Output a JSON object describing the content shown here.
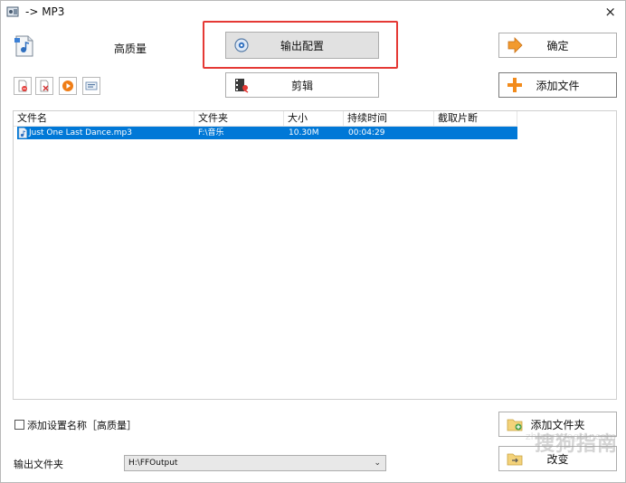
{
  "window": {
    "title": "-> MP3",
    "close_symbol": "×"
  },
  "preset": {
    "label": "高质量"
  },
  "buttons": {
    "output_config": "输出配置",
    "ok": "确定",
    "clip": "剪辑",
    "add_file": "添加文件",
    "add_folder": "添加文件夹",
    "change": "改变"
  },
  "toolbar_icons": [
    "remove-file-icon",
    "clear-list-icon",
    "play-icon",
    "info-icon"
  ],
  "table": {
    "columns": [
      "文件名",
      "文件夹",
      "大小",
      "持续时间",
      "截取片断"
    ],
    "rows": [
      {
        "name": "Just One Last Dance.mp3",
        "folder": "F:\\音乐",
        "size": "10.30M",
        "duration": "00:04:29",
        "clip": ""
      }
    ]
  },
  "options": {
    "add_setting_name_label": "添加设置名称［高质量］",
    "add_setting_name_checked": false
  },
  "output": {
    "label": "输出文件夹",
    "folder": "H:\\FFOutput"
  },
  "watermark": {
    "text": "搜狗指南",
    "url": "zhinan.sogou.com"
  },
  "colors": {
    "selection": "#0078d7",
    "highlight_border": "#e53935"
  }
}
